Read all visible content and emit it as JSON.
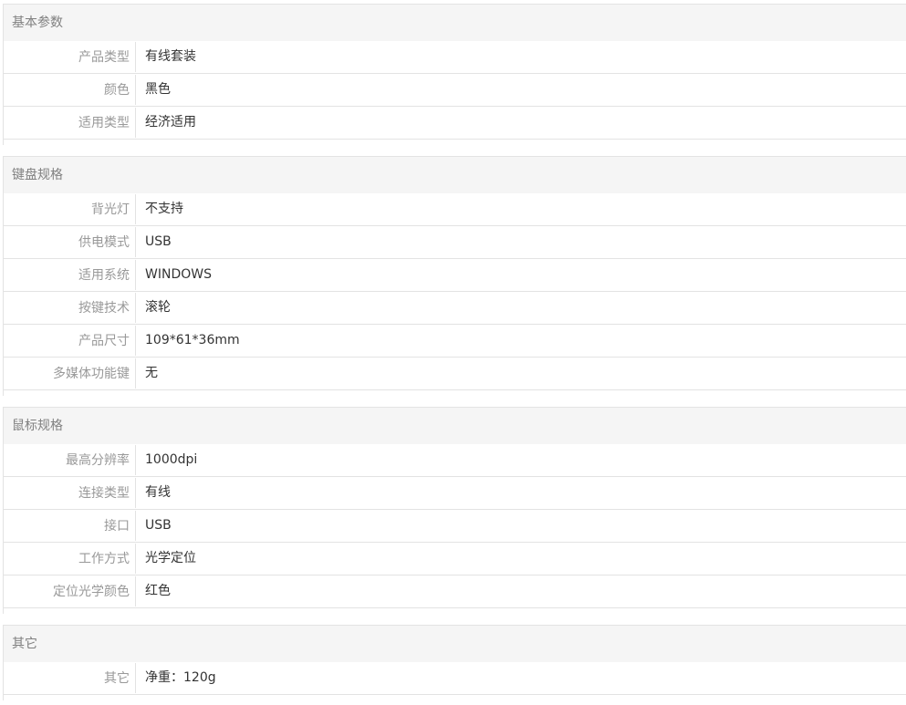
{
  "sections": [
    {
      "title": "基本参数",
      "rows": [
        {
          "key": "产品类型",
          "value": "有线套装"
        },
        {
          "key": "颜色",
          "value": "黑色"
        },
        {
          "key": "适用类型",
          "value": "经济适用"
        }
      ]
    },
    {
      "title": "键盘规格",
      "rows": [
        {
          "key": "背光灯",
          "value": "不支持"
        },
        {
          "key": "供电模式",
          "value": "USB"
        },
        {
          "key": "适用系统",
          "value": "WINDOWS"
        },
        {
          "key": "按键技术",
          "value": "滚轮"
        },
        {
          "key": "产品尺寸",
          "value": "109*61*36mm"
        },
        {
          "key": "多媒体功能键",
          "value": "无"
        }
      ]
    },
    {
      "title": "鼠标规格",
      "rows": [
        {
          "key": "最高分辨率",
          "value": "1000dpi"
        },
        {
          "key": "连接类型",
          "value": "有线"
        },
        {
          "key": "接口",
          "value": "USB"
        },
        {
          "key": "工作方式",
          "value": "光学定位"
        },
        {
          "key": "定位光学颜色",
          "value": "红色"
        }
      ]
    },
    {
      "title": "其它",
      "rows": [
        {
          "key": "其它",
          "value": "净重：120g"
        }
      ]
    }
  ]
}
